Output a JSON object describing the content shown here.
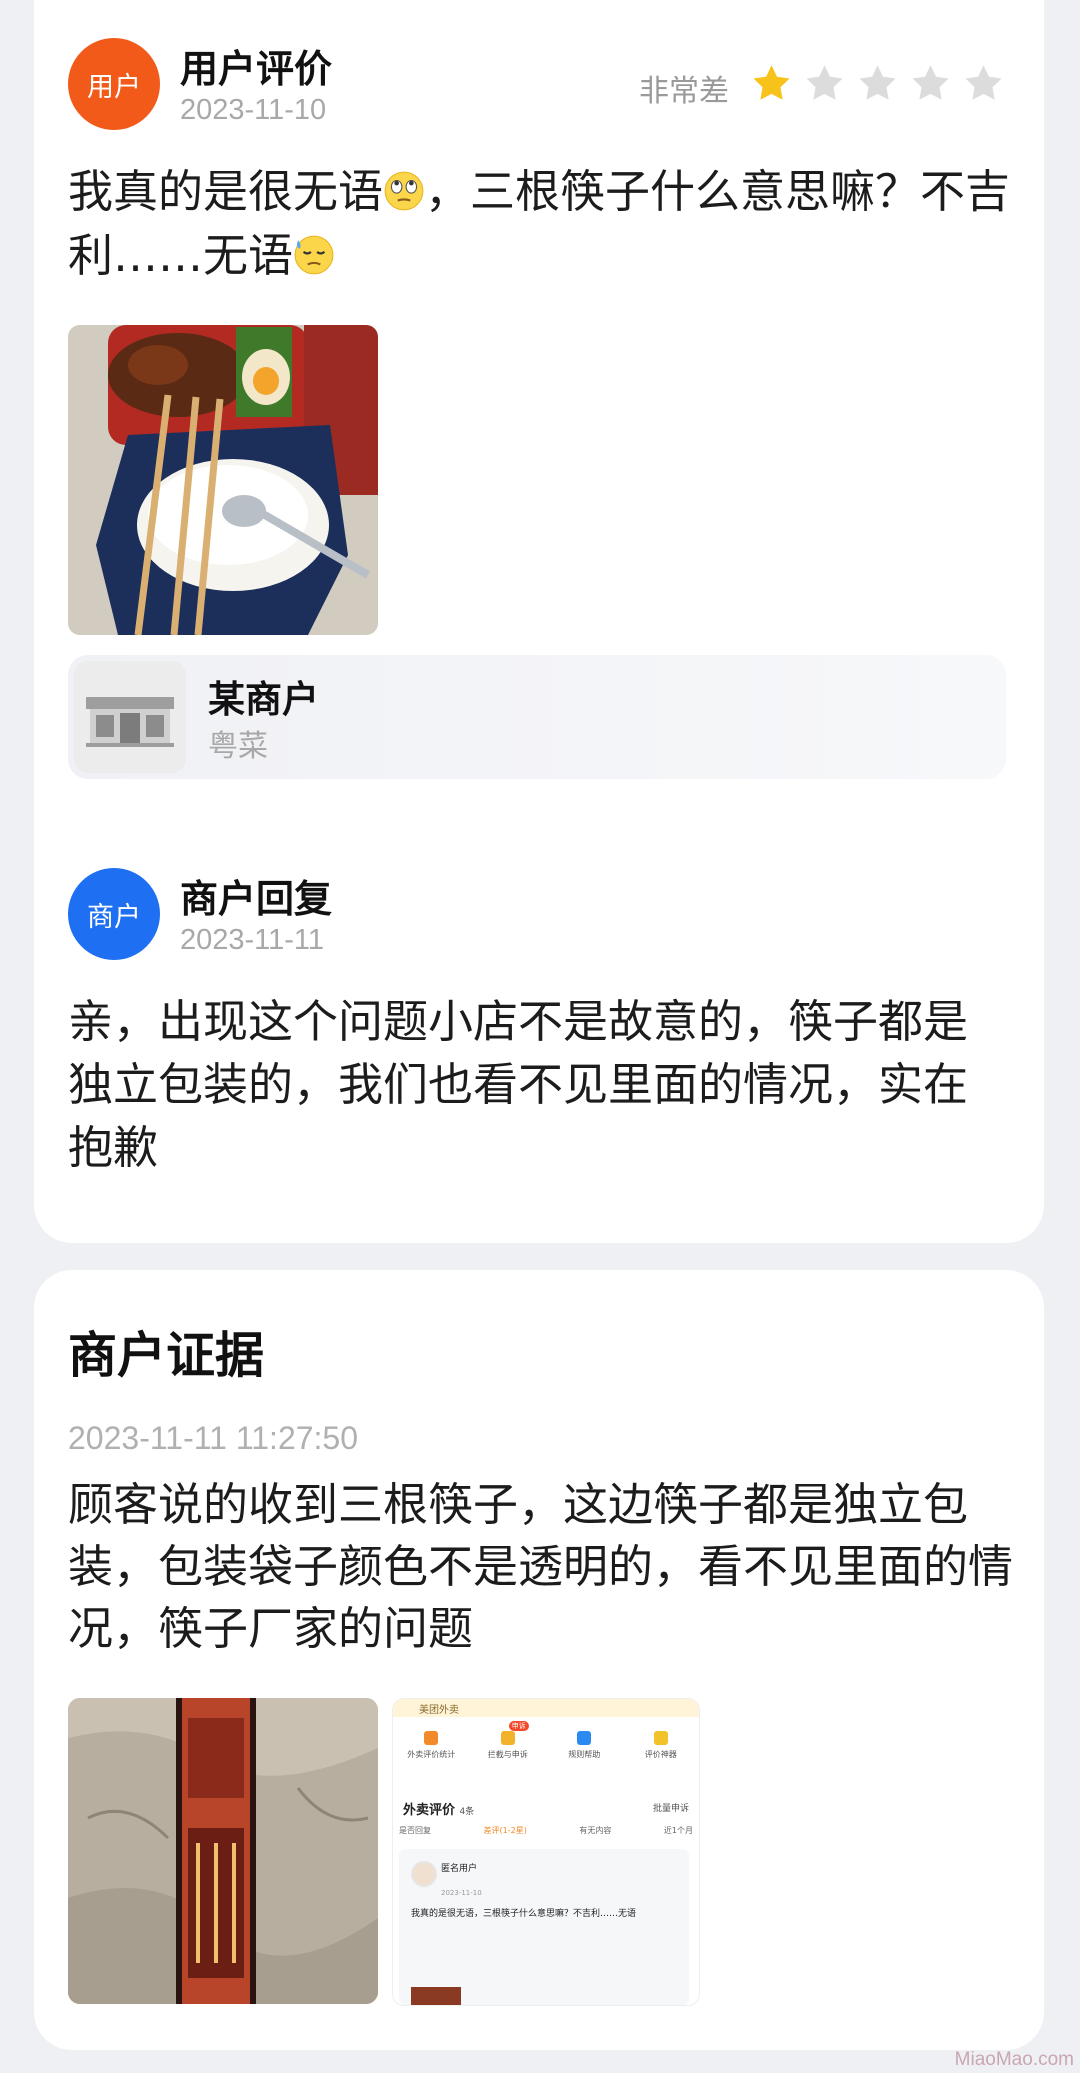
{
  "review": {
    "user": {
      "avatar_text": "用户",
      "name": "用户评价",
      "date": "2023-11-10",
      "rating_label": "非常差",
      "rating": 1,
      "rating_max": 5,
      "text_part1": "我真的是很无语",
      "text_part2": "，三根筷子什么意思嘛？不吉利……无语",
      "emoji1": "rolling-eyes-emoji",
      "emoji2": "sweat-emoji"
    },
    "shop": {
      "name": "某商户",
      "category": "粤菜",
      "icon": "storefront-icon"
    },
    "merchant_reply": {
      "avatar_text": "商户",
      "name": "商户回复",
      "date": "2023-11-11",
      "text": "亲，出现这个问题小店不是故意的，筷子都是独立包装的，我们也看不见里面的情况，实在抱歉"
    }
  },
  "evidence": {
    "title": "商户证据",
    "time": "2023-11-11 11:27:50",
    "text": "顾客说的收到三根筷子，这边筷子都是独立包装，包装袋子颜色不是透明的，看不见里面的情况，筷子厂家的问题",
    "screenshot": {
      "banner": "美团外卖",
      "menu": [
        "外卖评价统计",
        "拦截与申诉",
        "规则帮助",
        "评价神器"
      ],
      "badge": "申诉",
      "heading": "外卖评价",
      "count": "4条",
      "batch": "批量申诉",
      "filters": [
        "是否回复",
        "差评(1-2星)",
        "有无内容",
        "近1个月"
      ],
      "reviewer": "匿名用户",
      "date": "2023-11-10",
      "review_text": "我真的是很无语，三根筷子什么意思嘛？不吉利……无语"
    }
  },
  "watermark": "MiaoMao.com",
  "colors": {
    "user_avatar": "#f25a1a",
    "merchant_avatar": "#1f6ff2",
    "star_on": "#f7c21a",
    "star_off": "#dcdcdc"
  }
}
